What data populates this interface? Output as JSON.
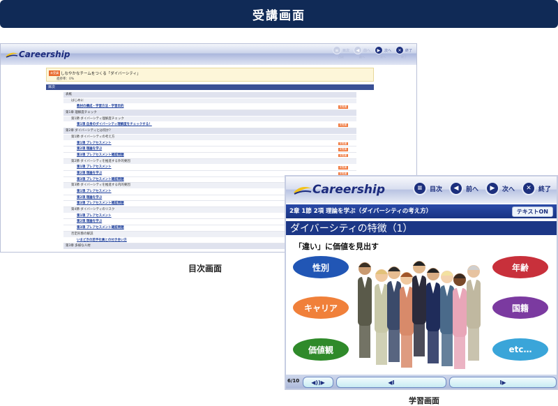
{
  "banner": {
    "title": "受講画面"
  },
  "toc_screen": {
    "logo_text": "Careership",
    "nav": [
      {
        "label": "目次",
        "sub": "目次",
        "icon": "list-icon",
        "dim": true
      },
      {
        "label": "前へ",
        "sub": "前へ",
        "icon": "prev-icon",
        "dim": true
      },
      {
        "label": "次へ",
        "sub": "次へ",
        "icon": "next-icon",
        "dim": false
      },
      {
        "label": "終了",
        "sub": "終了",
        "icon": "close-icon",
        "dim": false
      }
    ],
    "course": {
      "badge": "未受講",
      "title": "しなやかなチームをつくる「ダイバーシティ」",
      "rate": "進捗率：0%"
    },
    "toc_heading": "目次",
    "rows": [
      {
        "kind": "sec",
        "indent": 0,
        "text": "表紙",
        "status": ""
      },
      {
        "kind": "sub",
        "indent": 1,
        "text": "はじめに",
        "status": ""
      },
      {
        "kind": "item",
        "indent": 2,
        "text": "教材の構成・学習方法・学習目的",
        "status": "未受講"
      },
      {
        "kind": "sec",
        "indent": 0,
        "text": "第1章 理解度チェック",
        "status": ""
      },
      {
        "kind": "sub",
        "indent": 1,
        "text": "第1節 ダイバーシティ理解度チェック",
        "status": ""
      },
      {
        "kind": "item",
        "indent": 2,
        "text": "第1項 自身のダイバーシティ理解度をチェックする！",
        "status": "未受講"
      },
      {
        "kind": "sec",
        "indent": 0,
        "text": "第2章 ダイバーシティとは何か？",
        "status": ""
      },
      {
        "kind": "sub",
        "indent": 1,
        "text": "第1節 ダイバーシティの考え方",
        "status": ""
      },
      {
        "kind": "item",
        "indent": 2,
        "text": "第1項 プレアセスメント",
        "status": "未受講"
      },
      {
        "kind": "item",
        "indent": 2,
        "text": "第2項 理論を学ぶ",
        "status": "未受講"
      },
      {
        "kind": "item",
        "indent": 2,
        "text": "第3項 プレアセスメント確認問題",
        "status": "未受講"
      },
      {
        "kind": "sub",
        "indent": 1,
        "text": "第2節 ダイバーシティを推進する外的要因",
        "status": ""
      },
      {
        "kind": "item",
        "indent": 2,
        "text": "第1項 プレアセスメント",
        "status": "未受講"
      },
      {
        "kind": "item",
        "indent": 2,
        "text": "第2項 理論を学ぶ",
        "status": "未受講"
      },
      {
        "kind": "item",
        "indent": 2,
        "text": "第3項 プレアセスメント確認問題",
        "status": "未受講"
      },
      {
        "kind": "sub",
        "indent": 1,
        "text": "第3節 ダイバーシティを推進する内的要因",
        "status": ""
      },
      {
        "kind": "item",
        "indent": 2,
        "text": "第1項 プレアセスメント",
        "status": "未受講"
      },
      {
        "kind": "item",
        "indent": 2,
        "text": "第2項 理論を学ぶ",
        "status": "未受講"
      },
      {
        "kind": "item",
        "indent": 2,
        "text": "第3項 プレアセスメント確認問題",
        "status": "未受講"
      },
      {
        "kind": "sub",
        "indent": 1,
        "text": "第4節 ダイバーシティのリスク",
        "status": ""
      },
      {
        "kind": "item",
        "indent": 2,
        "text": "第1項 プレアセスメント",
        "status": "未受講"
      },
      {
        "kind": "item",
        "indent": 2,
        "text": "第2項 理論を学ぶ",
        "status": "未受講"
      },
      {
        "kind": "item",
        "indent": 2,
        "text": "第3項 プレアセスメント確認問題",
        "status": "未受講"
      },
      {
        "kind": "sub",
        "indent": 1,
        "text": "否定形態の解説",
        "status": ""
      },
      {
        "kind": "item",
        "indent": 2,
        "text": "いまどきの若手社員との付き合い方",
        "status": "未受講"
      },
      {
        "kind": "sec",
        "indent": 0,
        "text": "第3章 多様な人材",
        "status": ""
      }
    ],
    "caption": "目次画面"
  },
  "study_screen": {
    "logo_text": "Careership",
    "nav": [
      {
        "label": "目次",
        "icon": "list-icon"
      },
      {
        "label": "前へ",
        "icon": "prev-icon"
      },
      {
        "label": "次へ",
        "icon": "next-icon"
      },
      {
        "label": "終了",
        "icon": "close-icon"
      }
    ],
    "chapter": "2章 1節 2項 理論を学ぶ（ダイバーシティの考え方）",
    "text_toggle": "テキストON",
    "slide_title": "ダイバーシティの特徴（1）",
    "slide_subtitle": "「違い」に価値を見出す",
    "ovals": [
      {
        "label": "性別",
        "color": "#2156b5"
      },
      {
        "label": "キャリア",
        "color": "#f0803a"
      },
      {
        "label": "価値観",
        "color": "#2f8a2a"
      },
      {
        "label": "年齢",
        "color": "#c8303b"
      },
      {
        "label": "国籍",
        "color": "#7b3aa0"
      },
      {
        "label": "etc…",
        "color": "#3aa5d9"
      }
    ],
    "page": "6/10",
    "audio_label": "◀))▶",
    "prev_label": "◀I",
    "next_label": "I▶",
    "caption": "学習画面"
  }
}
